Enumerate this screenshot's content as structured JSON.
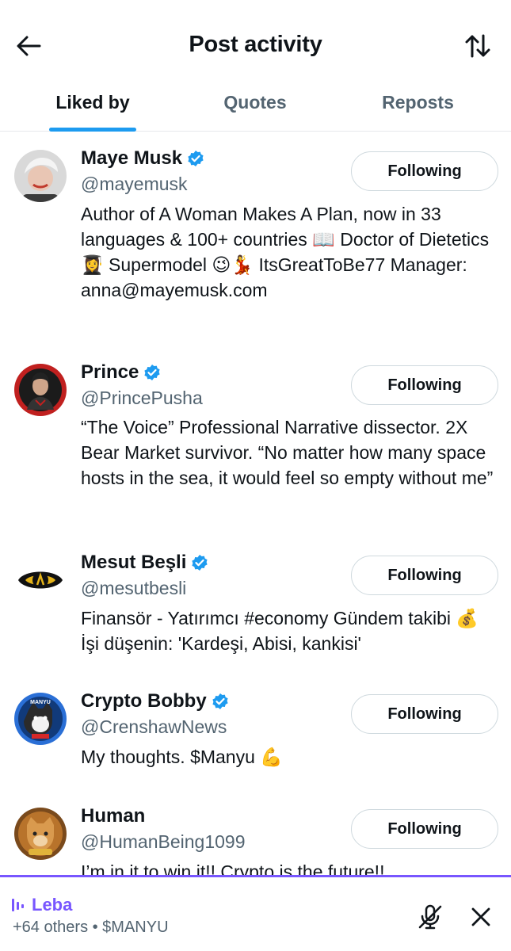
{
  "header": {
    "title": "Post activity"
  },
  "tabs": [
    {
      "label": "Liked by"
    },
    {
      "label": "Quotes"
    },
    {
      "label": "Reposts"
    }
  ],
  "colors": {
    "accent": "#1d9bf0",
    "spaces": "#7856ff",
    "muted": "#536471"
  },
  "users": [
    {
      "name": "Maye Musk",
      "handle": "@mayemusk",
      "bio": "Author of A Woman Makes A Plan, now in 33 languages & 100+ countries 📖 Doctor of Dietetics 👩‍🎓 Supermodel 😉💃 ItsGreatToBe77 Manager: anna@mayemusk.com",
      "button": "Following"
    },
    {
      "name": "Prince",
      "handle": "@PrincePusha",
      "bio": "“The Voice” Professional Narrative dissector. 2X Bear Market survivor. “No matter how many space hosts in the sea, it would feel so empty without me”",
      "button": "Following"
    },
    {
      "name": "Mesut Beşli",
      "handle": "@mesutbesli",
      "bio": "Finansör - Yatırımcı #economy Gündem takibi 💰İşi düşenin: 'Kardeşi, Abisi, kankisi'",
      "button": "Following"
    },
    {
      "name": "Crypto Bobby",
      "handle": "@CrenshawNews",
      "bio": "My thoughts. $Manyu 💪",
      "button": "Following"
    },
    {
      "name": "Human",
      "handle": "@HumanBeing1099",
      "bio": "I’m in it to win it!! Crypto is the future!!",
      "button": "Following"
    }
  ],
  "space": {
    "host": "Leba",
    "others": "+64 others • $MANYU"
  }
}
